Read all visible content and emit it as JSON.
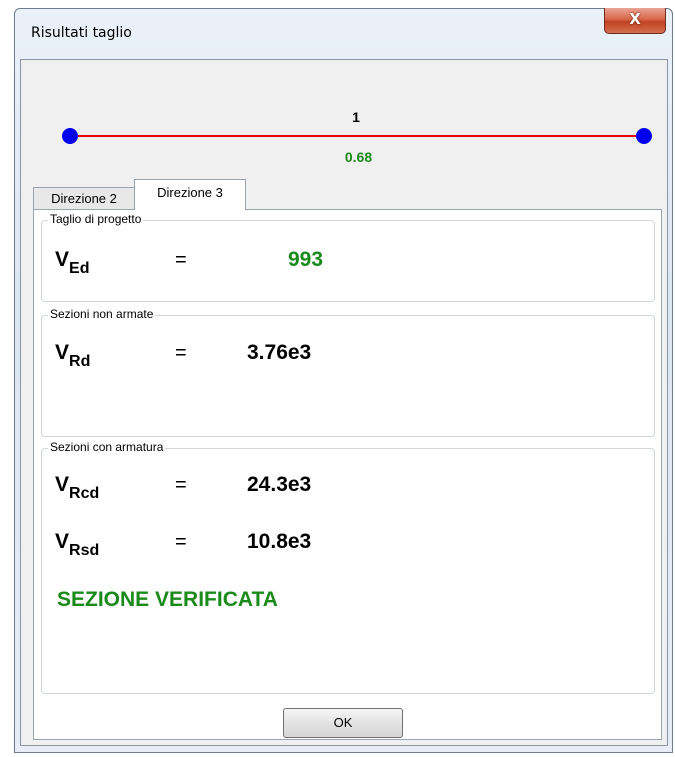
{
  "window": {
    "title": "Risultati taglio",
    "close_glyph": "X"
  },
  "beam": {
    "label_top": "1",
    "label_bottom": "0.68",
    "line_color": "#e60000",
    "node_color": "#0000ee",
    "label_bottom_color": "#1a8a1a"
  },
  "tabs": [
    {
      "label": "Direzione 2",
      "active": false
    },
    {
      "label": "Direzione 3",
      "active": true
    }
  ],
  "groups": {
    "design_shear": {
      "legend": "Taglio di progetto",
      "rows": [
        {
          "symbol": "V",
          "subscript": "Ed",
          "equals": "=",
          "value": "993"
        }
      ]
    },
    "unreinforced": {
      "legend": "Sezioni non armate",
      "rows": [
        {
          "symbol": "V",
          "subscript": "Rd",
          "equals": "=",
          "value": "3.76e3"
        }
      ]
    },
    "reinforced": {
      "legend": "Sezioni con armatura",
      "rows": [
        {
          "symbol": "V",
          "subscript": "Rcd",
          "equals": "=",
          "value": "24.3e3"
        },
        {
          "symbol": "V",
          "subscript": "Rsd",
          "equals": "=",
          "value": "10.8e3"
        }
      ],
      "verdict": "SEZIONE VERIFICATA"
    }
  },
  "buttons": {
    "ok_label": "OK"
  },
  "colors": {
    "ok_green": "#1a8a1a"
  }
}
